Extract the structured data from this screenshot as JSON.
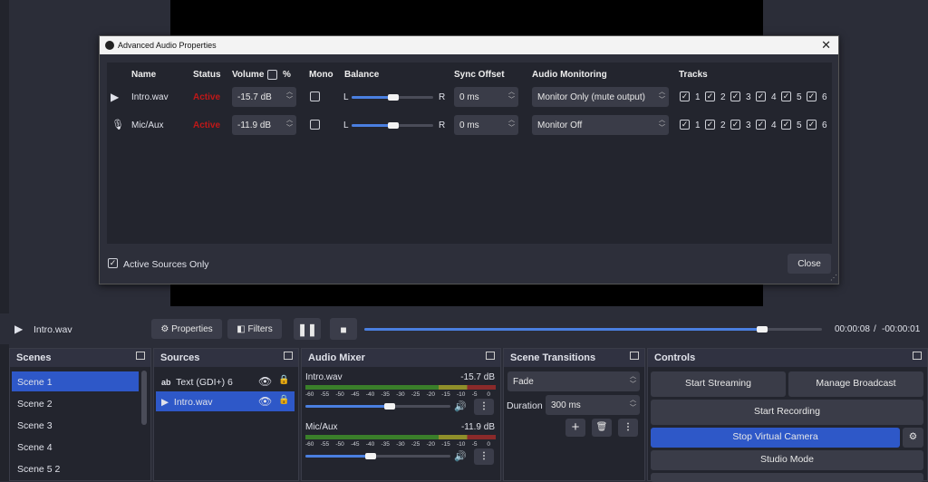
{
  "dialog": {
    "title": "Advanced Audio Properties",
    "headers": {
      "name": "Name",
      "status": "Status",
      "volume": "Volume",
      "pct": "%",
      "mono": "Mono",
      "balance": "Balance",
      "sync": "Sync Offset",
      "monitoring": "Audio Monitoring",
      "tracks": "Tracks"
    },
    "rows": [
      {
        "name": "Intro.wav",
        "status": "Active",
        "volume": "-15.7 dB",
        "sync": "0 ms",
        "monitoring": "Monitor Only (mute output)",
        "balance_left": "L",
        "balance_right": "R",
        "balance": 0.5
      },
      {
        "name": "Mic/Aux",
        "status": "Active",
        "volume": "-11.9 dB",
        "sync": "0 ms",
        "monitoring": "Monitor Off",
        "balance_left": "L",
        "balance_right": "R",
        "balance": 0.5
      }
    ],
    "track_labels": [
      "1",
      "2",
      "3",
      "4",
      "5",
      "6"
    ],
    "active_only": "Active Sources Only",
    "close": "Close"
  },
  "transport": {
    "source": "Intro.wav",
    "properties": "Properties",
    "filters": "Filters",
    "progress": 0.98,
    "time": "00:00:08",
    "sep": "/",
    "remaining": "-00:00:01"
  },
  "scenes": {
    "title": "Scenes",
    "items": [
      "Scene 1",
      "Scene 2",
      "Scene 3",
      "Scene 4",
      "Scene 5 2"
    ]
  },
  "sources": {
    "title": "Sources",
    "items": [
      "Text (GDI+) 6",
      "Intro.wav"
    ]
  },
  "mixer": {
    "title": "Audio Mixer",
    "channels": [
      {
        "name": "Intro.wav",
        "db": "-15.7 dB",
        "level": 0.58
      },
      {
        "name": "Mic/Aux",
        "db": "-11.9 dB",
        "level": 0.45
      }
    ],
    "scale": [
      "-60",
      "-55",
      "-50",
      "-45",
      "-40",
      "-35",
      "-30",
      "-25",
      "-20",
      "-15",
      "-10",
      "-5",
      "0"
    ]
  },
  "transitions": {
    "title": "Scene Transitions",
    "type": "Fade",
    "duration_label": "Duration",
    "duration": "300 ms"
  },
  "controls": {
    "title": "Controls",
    "start_streaming": "Start Streaming",
    "manage_broadcast": "Manage Broadcast",
    "start_recording": "Start Recording",
    "stop_virtual_camera": "Stop Virtual Camera",
    "studio_mode": "Studio Mode",
    "accent": "#2e58c8"
  }
}
